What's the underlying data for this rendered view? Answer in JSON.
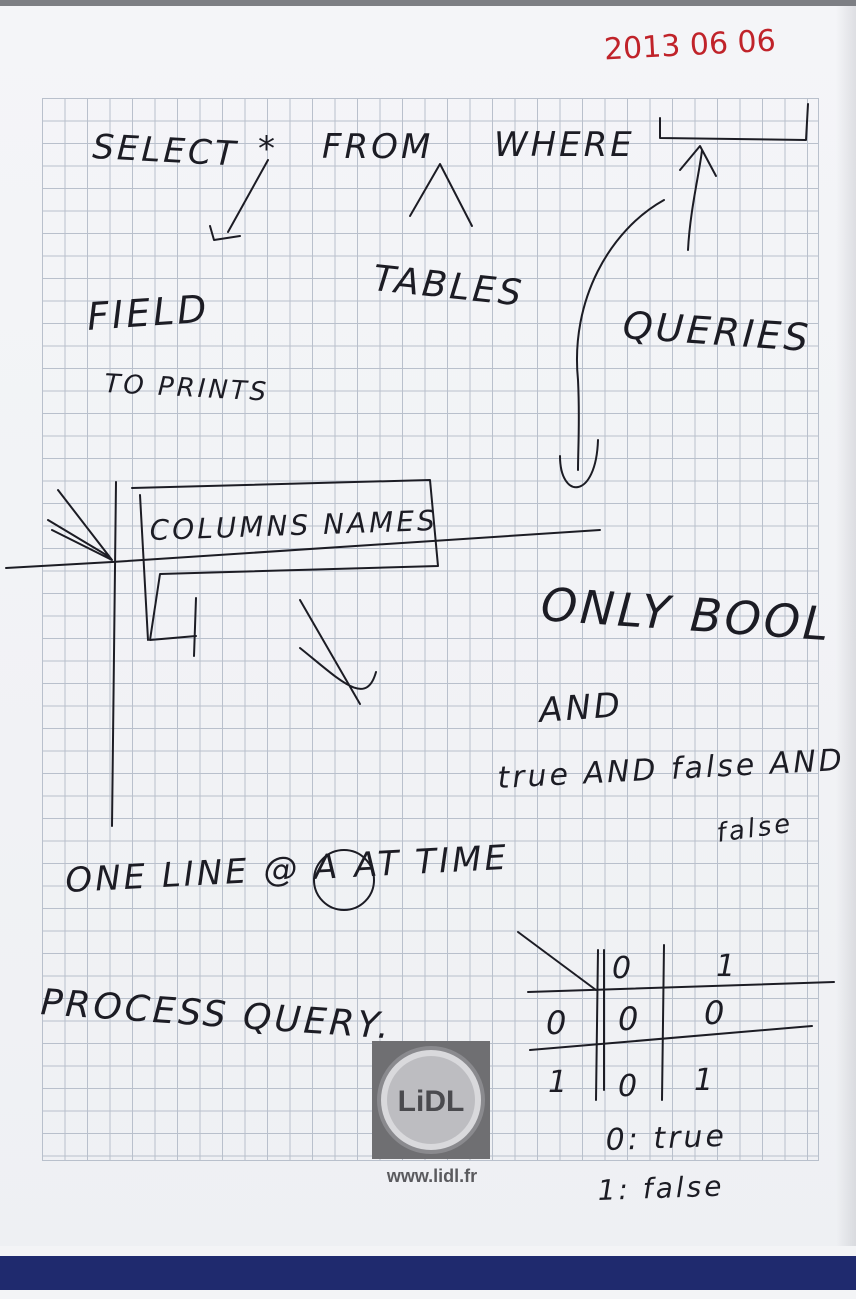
{
  "date_stamp": "2013 06 06",
  "notes": {
    "select_line": [
      "SELECT",
      "*",
      "FROM",
      "WHERE"
    ],
    "field_label": "FIELD",
    "to_print_label": "TO PRINTS",
    "tables_label": "TABLES",
    "queries_label": "QUERIES",
    "column_names_label": "COLUMNS NAMES",
    "only_bool_label": "ONLY BOOL",
    "and_label": "AND",
    "true_and_false_label": "true AND false AND",
    "false_result_label": "false",
    "one_line_label": "ONE LINE @ A AT TIME",
    "process_query_label": "PROCESS QUERY.",
    "legend_true": "0: true",
    "legend_false": "1: false"
  },
  "truth_table": {
    "header": [
      "0",
      "1"
    ],
    "rows": [
      {
        "label": "0",
        "cells": [
          "0",
          "0"
        ]
      },
      {
        "label": "1",
        "cells": [
          "0",
          "1"
        ]
      }
    ]
  },
  "logo": {
    "text": "LiDL",
    "url": "www.lidl.fr",
    "colors": {
      "yellow": "#f1d51a",
      "red": "#d3202a",
      "blue": "#1a3b8f",
      "frame": "#6f6f72"
    }
  },
  "colors": {
    "ink": "#1c1c24",
    "date_ink": "#c0232a",
    "grid": "#b9c0cc",
    "bottom_strip": "#1f2a6e"
  }
}
